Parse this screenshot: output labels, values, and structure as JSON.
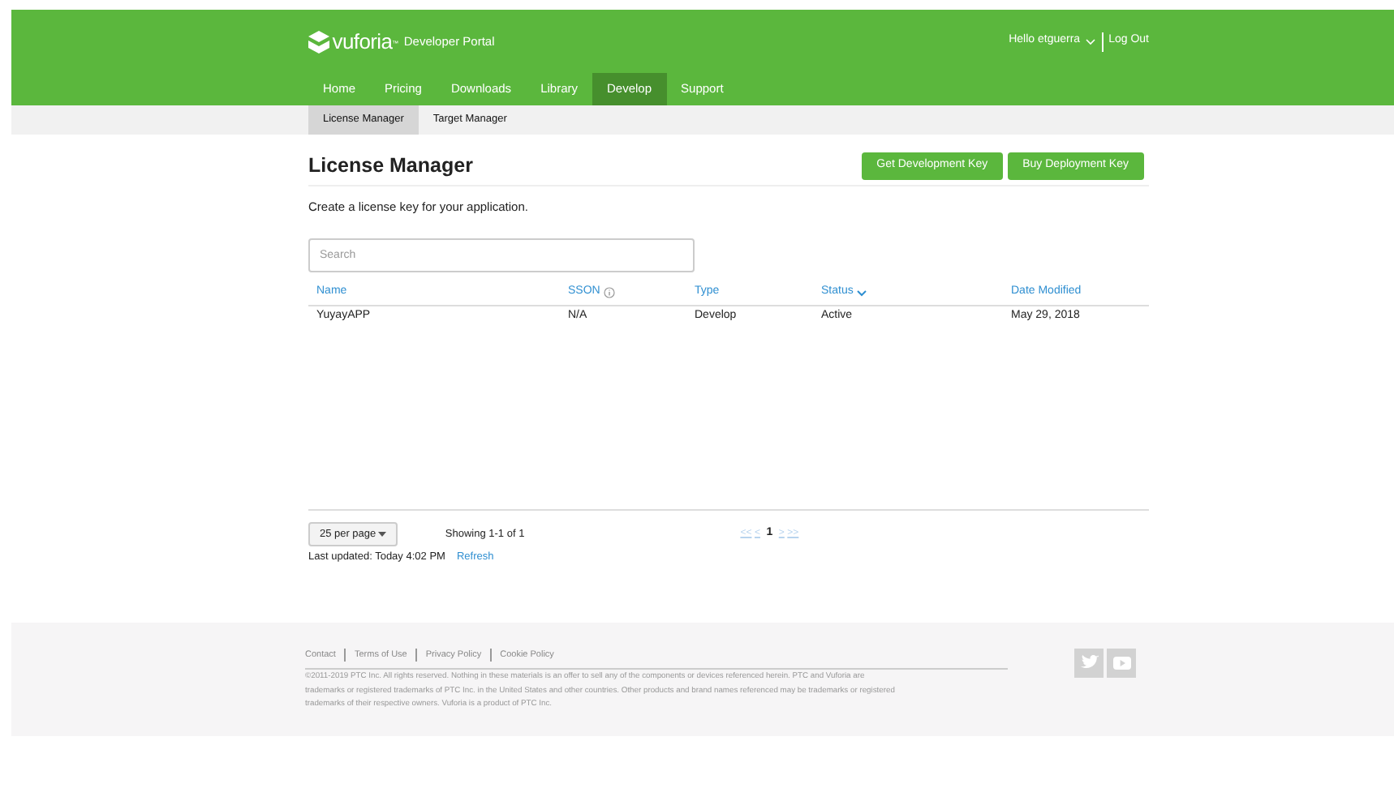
{
  "header": {
    "brand": "vuforia",
    "brand_mark": "™",
    "portal": "Developer Portal",
    "user_menu": "Hello etguerra",
    "logout": "Log Out"
  },
  "nav": [
    {
      "label": "Home",
      "selected": false
    },
    {
      "label": "Pricing",
      "selected": false
    },
    {
      "label": "Downloads",
      "selected": false
    },
    {
      "label": "Library",
      "selected": false
    },
    {
      "label": "Develop",
      "selected": true
    },
    {
      "label": "Support",
      "selected": false
    }
  ],
  "subnav": [
    {
      "label": "License Manager",
      "selected": true
    },
    {
      "label": "Target Manager",
      "selected": false
    }
  ],
  "page": {
    "title": "License Manager",
    "buttons": [
      "Get Development Key",
      "Buy Deployment Key"
    ],
    "intro": "Create a license key for your application.",
    "search": {
      "placeholder": "Search"
    }
  },
  "table": {
    "columns": [
      {
        "label": "Name",
        "info": false,
        "sorted": false
      },
      {
        "label": "SSON",
        "info": true,
        "sorted": false
      },
      {
        "label": "Type",
        "info": false,
        "sorted": false
      },
      {
        "label": "Status",
        "info": false,
        "sorted": true
      },
      {
        "label": "Date Modified",
        "info": false,
        "sorted": false
      }
    ],
    "rows": [
      [
        "YuyayAPP",
        "N/A",
        "Develop",
        "Active",
        "May 29, 2018"
      ]
    ]
  },
  "pager": {
    "per_page": "25",
    "per_page_label": "per page",
    "showing": "Showing 1-1 of 1",
    "first": "<<",
    "prev": "<",
    "current": "1",
    "next": ">",
    "last": ">>",
    "last_updated": "Last updated: Today 4:02 PM",
    "refresh": "Refresh"
  },
  "footer": {
    "links": [
      "Contact",
      "Terms of Use",
      "Privacy Policy",
      "Cookie Policy"
    ],
    "copyright": "©2011-2019 PTC Inc. All rights reserved. Nothing in these materials is an offer to sell any of the components or devices referenced herein. PTC and Vuforia are trademarks or registered trademarks of PTC Inc. in the United States and other countries. Other products and brand names referenced may be trademarks or registered trademarks of their respective owners. Vuforia is a product of PTC Inc."
  }
}
